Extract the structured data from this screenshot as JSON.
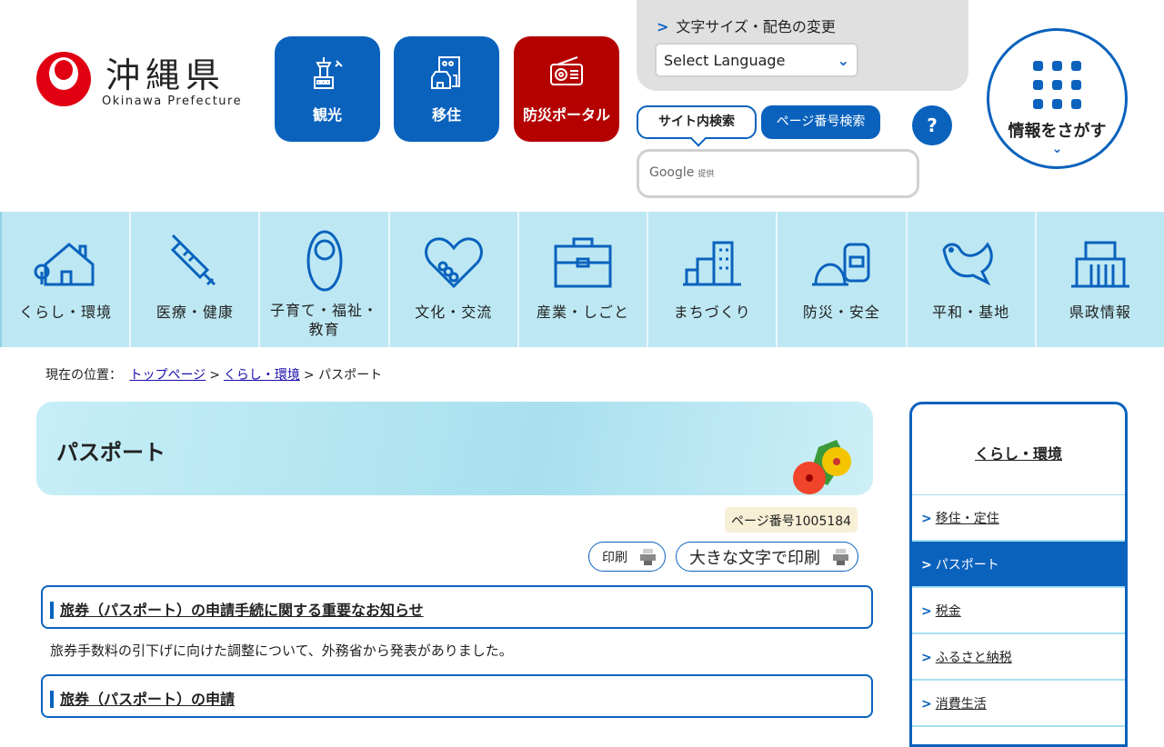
{
  "logo": {
    "name_jp": "沖縄県",
    "name_en": "Okinawa Prefecture"
  },
  "quick_links": [
    {
      "label": "観光",
      "color": "#0a62bd"
    },
    {
      "label": "移住",
      "color": "#0a62bd"
    },
    {
      "label": "防災ポータル",
      "color": "#b50000"
    }
  ],
  "utility": {
    "font_color_link": "文字サイズ・配色の変更",
    "language_select": "Select Language"
  },
  "search": {
    "tab_site": "サイト内検索",
    "tab_page_number": "ページ番号検索",
    "help": "?",
    "google_label": "Google",
    "google_suffix": "提供"
  },
  "info_search": {
    "label": "情報をさがす"
  },
  "nav": [
    "くらし・環境",
    "医療・健康",
    "子育て・福祉・教育",
    "文化・交流",
    "産業・しごと",
    "まちづくり",
    "防災・安全",
    "平和・基地",
    "県政情報"
  ],
  "breadcrumb": {
    "prefix": "現在の位置：",
    "items": [
      "トップページ",
      "くらし・環境"
    ],
    "current": "パスポート",
    "sep": ">"
  },
  "page": {
    "title": "パスポート",
    "page_number": "ページ番号1005184",
    "print": "印刷",
    "print_large": "大きな文字で印刷"
  },
  "sections": [
    {
      "heading": "旅券（パスポート）の申請手続に関する重要なお知らせ",
      "text": "旅券手数料の引下げに向けた調整について、外務省から発表がありました。"
    },
    {
      "heading": "旅券（パスポート）の申請"
    }
  ],
  "sidebar": {
    "title": "くらし・環境",
    "items": [
      {
        "label": "移住・定住"
      },
      {
        "label": "パスポート",
        "active": true
      },
      {
        "label": "税金"
      },
      {
        "label": "ふるさと納税"
      },
      {
        "label": "消費生活"
      }
    ]
  }
}
